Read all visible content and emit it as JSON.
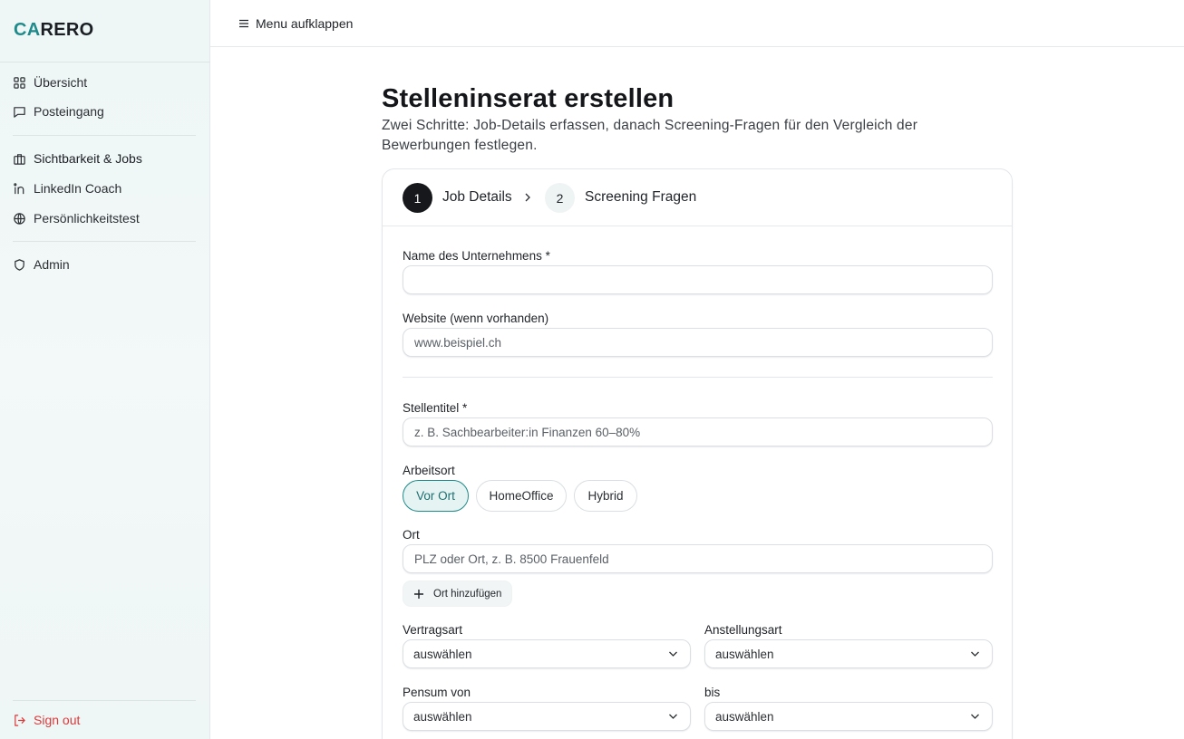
{
  "brand": {
    "logo_accent": "CA",
    "logo_rest": "RERO",
    "accent_color": "#1f8a8a"
  },
  "sidebar": {
    "items": [
      {
        "label": "Übersicht",
        "icon": "grid-icon"
      },
      {
        "label": "Posteingang",
        "icon": "message-icon"
      },
      {
        "label": "Sichtbarkeit & Jobs",
        "icon": "briefcase-icon",
        "active": true
      },
      {
        "label": "LinkedIn Coach",
        "icon": "linkedin-icon"
      },
      {
        "label": "Persönlichkeitstest",
        "icon": "globe-icon"
      },
      {
        "label": "Admin",
        "icon": "shield-icon"
      }
    ],
    "signout_label": "Sign out"
  },
  "topbar": {
    "menu_label": "Menu aufklappen"
  },
  "page": {
    "title": "Stelleninserat erstellen",
    "subtitle": "Zwei Schritte: Job-Details erfassen, danach Screening-Fragen für den Vergleich der Bewerbungen festlegen."
  },
  "steps": [
    {
      "number": "1",
      "label": "Job Details",
      "active": true
    },
    {
      "number": "2",
      "label": "Screening Fragen",
      "active": false
    }
  ],
  "form": {
    "company_label": "Name des Unternehmens *",
    "company_value": "",
    "website_label": "Website (wenn vorhanden)",
    "website_placeholder": "www.beispiel.ch",
    "title_label": "Stellentitel *",
    "title_placeholder": "z. B. Sachbearbeiter:in Finanzen 60–80%",
    "workplace_label": "Arbeitsort",
    "workplace_options": [
      "Vor Ort",
      "HomeOffice",
      "Hybrid"
    ],
    "workplace_selected": "Vor Ort",
    "location_label": "Ort",
    "location_placeholder": "PLZ oder Ort, z. B. 8500 Frauenfeld",
    "add_location_label": "Ort hinzufügen",
    "contract_label": "Vertragsart",
    "contract_value": "auswählen",
    "employment_label": "Anstellungsart",
    "employment_value": "auswählen",
    "workload_from_label": "Pensum von",
    "workload_from_value": "auswählen",
    "workload_to_label": "bis",
    "workload_to_value": "auswählen"
  }
}
